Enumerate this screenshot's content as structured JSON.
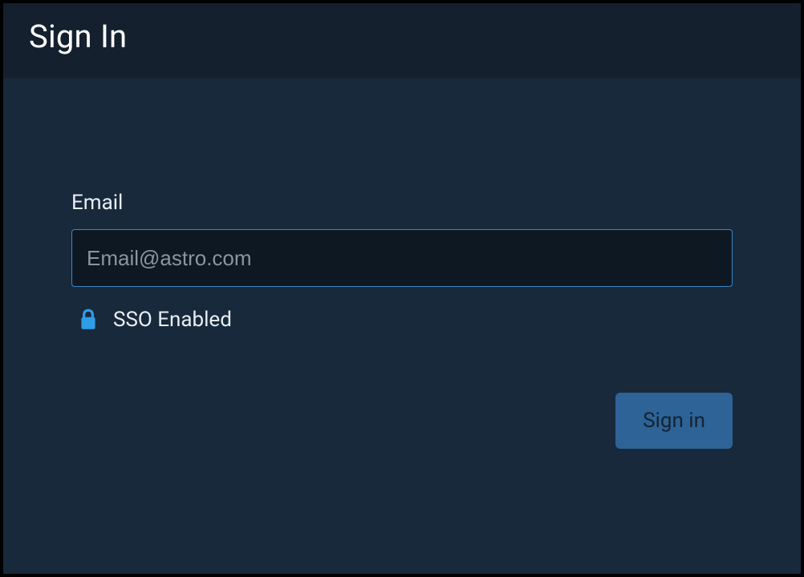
{
  "header": {
    "title": "Sign In"
  },
  "form": {
    "email_label": "Email",
    "email_placeholder": "Email@astro.com",
    "sso_status": "SSO Enabled",
    "submit_label": "Sign in"
  },
  "icons": {
    "lock": "lock-icon"
  },
  "colors": {
    "accent": "#3a87c4",
    "lock_icon": "#2f9ce8",
    "button_bg": "#2d6396",
    "bg_header": "#14202e",
    "bg_body": "#18293b",
    "input_bg": "#0e1823"
  }
}
